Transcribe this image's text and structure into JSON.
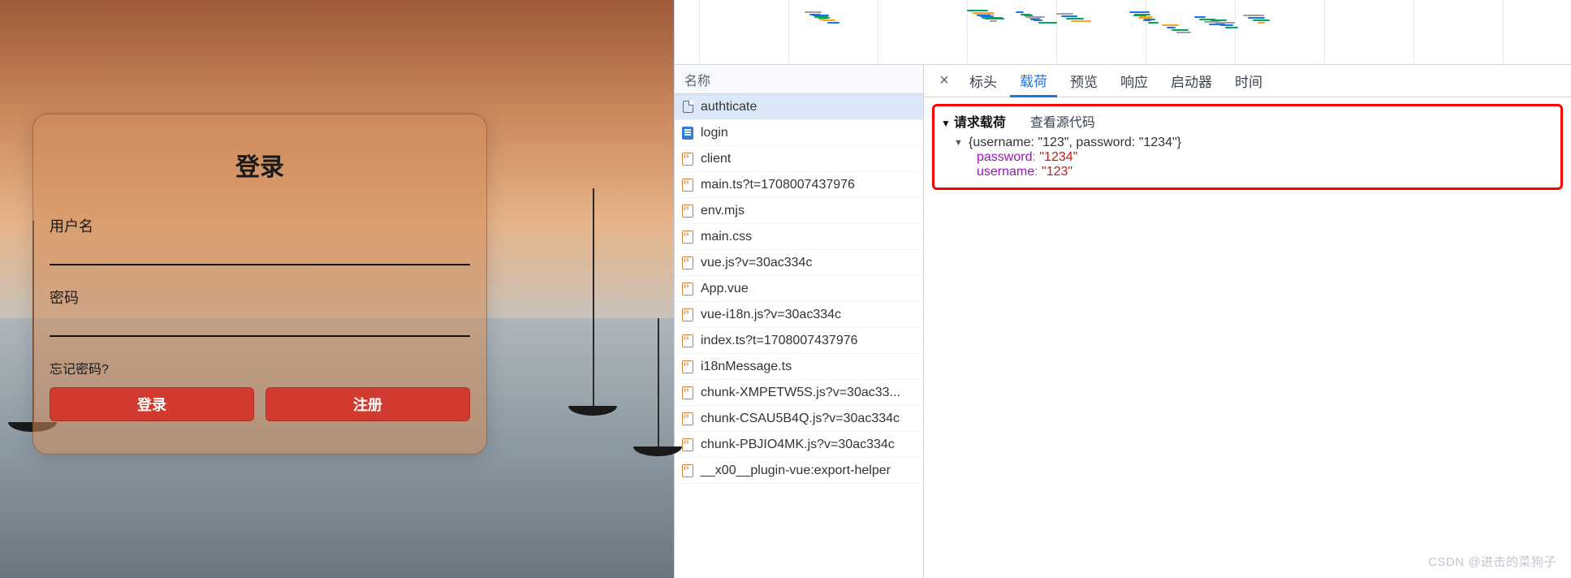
{
  "login": {
    "title": "登录",
    "username_label": "用户名",
    "password_label": "密码",
    "forgot": "忘记密码?",
    "login_btn": "登录",
    "register_btn": "注册",
    "username_value": "",
    "password_value": ""
  },
  "network": {
    "header": "名称",
    "requests": [
      {
        "name": "authticate",
        "type": "doc",
        "selected": true
      },
      {
        "name": "login",
        "type": "html"
      },
      {
        "name": "client",
        "type": "js"
      },
      {
        "name": "main.ts?t=1708007437976",
        "type": "js"
      },
      {
        "name": "env.mjs",
        "type": "js"
      },
      {
        "name": "main.css",
        "type": "js"
      },
      {
        "name": "vue.js?v=30ac334c",
        "type": "js"
      },
      {
        "name": "App.vue",
        "type": "js"
      },
      {
        "name": "vue-i18n.js?v=30ac334c",
        "type": "js"
      },
      {
        "name": "index.ts?t=1708007437976",
        "type": "js"
      },
      {
        "name": "i18nMessage.ts",
        "type": "js"
      },
      {
        "name": "chunk-XMPETW5S.js?v=30ac33...",
        "type": "js"
      },
      {
        "name": "chunk-CSAU5B4Q.js?v=30ac334c",
        "type": "js"
      },
      {
        "name": "chunk-PBJIO4MK.js?v=30ac334c",
        "type": "js"
      },
      {
        "name": "__x00__plugin-vue:export-helper",
        "type": "js"
      }
    ]
  },
  "details": {
    "tabs": {
      "headers": "标头",
      "payload": "载荷",
      "preview": "预览",
      "response": "响应",
      "initiator": "启动器",
      "timing": "时间"
    },
    "active_tab": "payload",
    "payload_title": "请求载荷",
    "view_source": "查看源代码",
    "payload_summary": "{username: \"123\", password: \"1234\"}",
    "payload_fields": [
      {
        "key": "password",
        "value": "\"1234\""
      },
      {
        "key": "username",
        "value": "\"123\""
      }
    ]
  },
  "watermark": "CSDN @进击的菜狗子"
}
